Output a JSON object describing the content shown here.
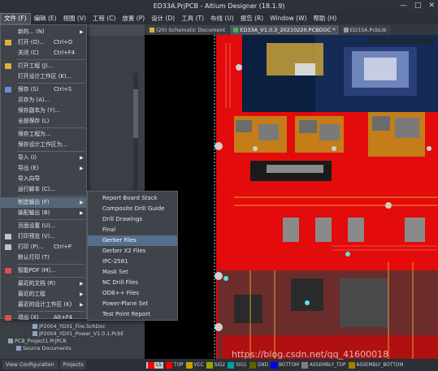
{
  "window": {
    "title": "ED33A.PrjPCB - Altium Designer (18.1.9)",
    "controls": [
      "—",
      "□",
      "✕"
    ]
  },
  "menubar": [
    {
      "label": "文件 (F)",
      "active": true
    },
    {
      "label": "编辑 (E)"
    },
    {
      "label": "视图 (V)"
    },
    {
      "label": "工程 (C)"
    },
    {
      "label": "放置 (P)"
    },
    {
      "label": "设计 (D)"
    },
    {
      "label": "工具 (T)"
    },
    {
      "label": "布线 (U)"
    },
    {
      "label": "报告 (R)"
    },
    {
      "label": "Window (W)"
    },
    {
      "label": "帮助 (H)"
    }
  ],
  "doc_tabs": [
    {
      "label": "(20) Schematic Document",
      "active": false
    },
    {
      "label": "ED33A_V1.0.3_20210220.PCBDOC *",
      "active": true
    },
    {
      "label": "ED33A.PcbLib",
      "active": false
    }
  ],
  "project_tree": [
    {
      "label": "CE.SchDoc *"
    },
    {
      "label": "CE.SchDoc"
    },
    {
      "label": "CE.SchDoc"
    },
    {
      "label": ".SchDoc"
    },
    {
      "label": ".SchDoc"
    },
    {
      "label": ".SchDoc"
    },
    {
      "label": ".SchDoc"
    },
    {
      "label": "JP2004_YD01_Fire.SchDoc"
    },
    {
      "label": "JP2004_YD01_Power_V1.0.1.PcbE"
    },
    {
      "label": "PCB_Project1.PrjPCB"
    },
    {
      "label": "Source Documents"
    }
  ],
  "file_menu": [
    {
      "label": "新的... (N)",
      "shortcut": "",
      "submenu": true,
      "icon": "none"
    },
    {
      "label": "打开 (O)...",
      "shortcut": "Ctrl+O",
      "submenu": false,
      "icon": "folder-icon"
    },
    {
      "label": "关闭 (C)",
      "shortcut": "Ctrl+F4",
      "submenu": false,
      "icon": "none"
    },
    {
      "label": "打开工程 (J)...",
      "shortcut": "",
      "submenu": false,
      "icon": "folder-icon"
    },
    {
      "label": "打开设计工作区 (K)...",
      "shortcut": "",
      "submenu": false,
      "icon": "none"
    },
    {
      "label": "保存 (S)",
      "shortcut": "Ctrl+S",
      "submenu": false,
      "icon": "save-icon"
    },
    {
      "label": "另存为 (A)...",
      "shortcut": "",
      "submenu": false,
      "icon": "none"
    },
    {
      "label": "保存副本为 (Y)...",
      "shortcut": "",
      "submenu": false,
      "icon": "none"
    },
    {
      "label": "全部保存 (L)",
      "shortcut": "",
      "submenu": false,
      "icon": "none"
    },
    {
      "label": "保存工程为...",
      "shortcut": "",
      "submenu": false,
      "icon": "none"
    },
    {
      "label": "保存设计工作区为...",
      "shortcut": "",
      "submenu": false,
      "icon": "none"
    },
    {
      "label": "导入 (I)",
      "shortcut": "",
      "submenu": true,
      "icon": "none"
    },
    {
      "label": "导出 (E)",
      "shortcut": "",
      "submenu": true,
      "icon": "none"
    },
    {
      "label": "导入向导",
      "shortcut": "",
      "submenu": false,
      "icon": "none"
    },
    {
      "label": "运行脚本 (C)...",
      "shortcut": "",
      "submenu": false,
      "icon": "none"
    },
    {
      "label": "制造输出 (F)",
      "shortcut": "",
      "submenu": true,
      "icon": "none",
      "highlight": true
    },
    {
      "label": "装配输出 (B)",
      "shortcut": "",
      "submenu": true,
      "icon": "none"
    },
    {
      "label": "页面设置 (U)...",
      "shortcut": "",
      "submenu": false,
      "icon": "none"
    },
    {
      "label": "打印预览 (V)...",
      "shortcut": "",
      "submenu": false,
      "icon": "printer-icon"
    },
    {
      "label": "打印 (P)...",
      "shortcut": "Ctrl+P",
      "submenu": false,
      "icon": "printer-icon"
    },
    {
      "label": "默认打印 (T)",
      "shortcut": "",
      "submenu": false,
      "icon": "none"
    },
    {
      "label": "智能PDF (M)...",
      "shortcut": "",
      "submenu": false,
      "icon": "pdf-icon"
    },
    {
      "label": "最近的文档 (R)",
      "shortcut": "",
      "submenu": true,
      "icon": "none"
    },
    {
      "label": "最近的工程",
      "shortcut": "",
      "submenu": true,
      "icon": "none"
    },
    {
      "label": "最近的设计工作区 (K)",
      "shortcut": "",
      "submenu": true,
      "icon": "none"
    },
    {
      "label": "退出 (X)",
      "shortcut": "Alt+F4",
      "submenu": false,
      "icon": "exit-icon"
    }
  ],
  "fab_submenu": [
    {
      "label": "Report Board Stack"
    },
    {
      "label": "Composite Drill Guide"
    },
    {
      "label": "Drill Drawings"
    },
    {
      "label": "Final"
    },
    {
      "label": "Gerber Files",
      "highlight": true
    },
    {
      "label": "Gerber X2 Files"
    },
    {
      "label": "IPC-2581"
    },
    {
      "label": "Mask Set"
    },
    {
      "label": "NC Drill Files"
    },
    {
      "label": "ODB++ Files"
    },
    {
      "label": "Power-Plane Set"
    },
    {
      "label": "Test Point Report"
    }
  ],
  "status": {
    "tabs": [
      "View Configuration",
      "Projects"
    ],
    "layers": [
      {
        "label": "LS",
        "color": "#ff0000"
      },
      {
        "label": "TOP",
        "color": "#ff0000"
      },
      {
        "label": "VCC",
        "color": "#c8a000"
      },
      {
        "label": "SIG2",
        "color": "#a0a000"
      },
      {
        "label": "SIG1",
        "color": "#00a0a0"
      },
      {
        "label": "GND",
        "color": "#606000"
      },
      {
        "label": "BOTTOM",
        "color": "#0000ff"
      },
      {
        "label": "ASSEMBLY_TOP",
        "color": "#808080"
      },
      {
        "label": "ASSEMBLY_BOTTOM",
        "color": "#a08000"
      }
    ]
  },
  "watermark": "https://blog.csdn.net/qq_41600018"
}
